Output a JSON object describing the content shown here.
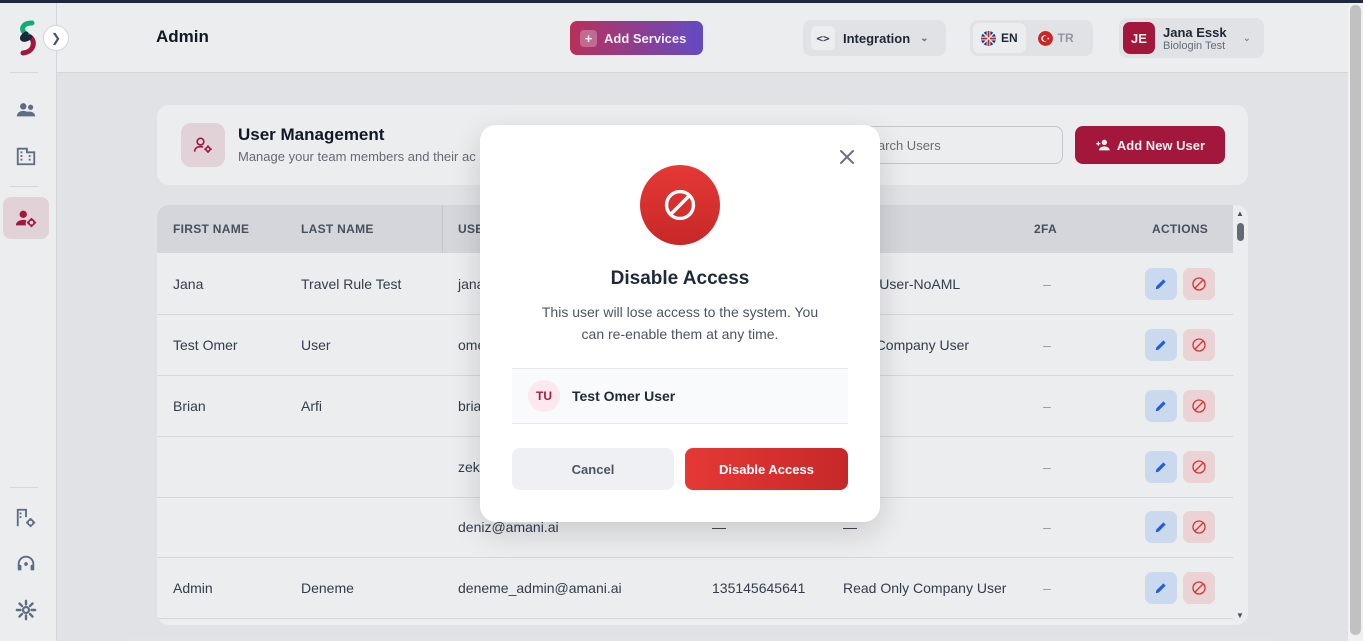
{
  "header": {
    "title": "Admin",
    "add_services_label": "Add Services",
    "integration_label": "Integration",
    "languages": [
      {
        "code": "EN",
        "active": true
      },
      {
        "code": "TR",
        "active": false
      }
    ],
    "user": {
      "initials": "JE",
      "name": "Jana Essk",
      "company": "Biologin Test"
    }
  },
  "sidebar": {
    "icons": [
      "logo",
      "users-icon",
      "building-icon",
      "user-settings-icon",
      "company-settings-icon",
      "support-icon",
      "settings-icon"
    ],
    "active": "user-settings-icon"
  },
  "user_management": {
    "title": "User Management",
    "subtitle": "Manage your team members and their ac",
    "search_placeholder": "Search Users",
    "add_user_label": "Add New User"
  },
  "table": {
    "columns": [
      "FIRST NAME",
      "LAST NAME",
      "USE",
      "2FA",
      "ACTIONS"
    ],
    "rows": [
      {
        "first": "Jana",
        "last": "Travel Rule Test",
        "email": "jana",
        "phone": "",
        "role": "Write User-NoAML",
        "twofa": "–"
      },
      {
        "first": "Test Omer",
        "last": "User",
        "email": "ome",
        "phone": "",
        "role": "Only Company User",
        "twofa": "–"
      },
      {
        "first": "Brian",
        "last": "Arfi",
        "email": "bria",
        "phone": "",
        "role": "",
        "twofa": "–"
      },
      {
        "first": "",
        "last": "",
        "email": "zek",
        "phone": "",
        "role": "",
        "twofa": "–"
      },
      {
        "first": "",
        "last": "",
        "email": "deniz@amani.ai",
        "phone": "—",
        "role": "—",
        "twofa": "–"
      },
      {
        "first": "Admin",
        "last": "Deneme",
        "email": "deneme_admin@amani.ai",
        "phone": "135145645641",
        "role": "Read Only Company User",
        "twofa": "–"
      }
    ]
  },
  "modal": {
    "title": "Disable Access",
    "description": "This user will lose access to the system. You can re-enable them at any time.",
    "user_initials": "TU",
    "user_name": "Test Omer User",
    "cancel_label": "Cancel",
    "confirm_label": "Disable Access"
  },
  "colors": {
    "brand": "#b0173f",
    "danger": "#e53935",
    "edit": "#2563eb"
  }
}
